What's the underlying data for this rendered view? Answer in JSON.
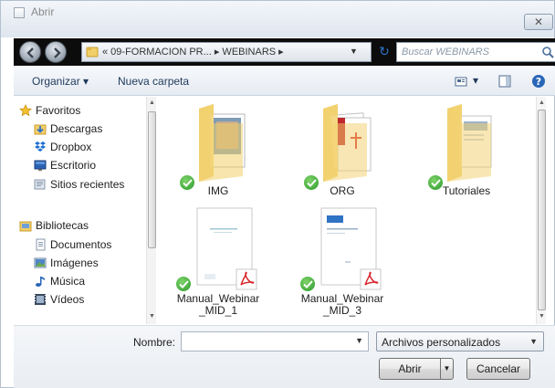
{
  "window": {
    "title": "Abrir",
    "close_glyph": "✕"
  },
  "nav": {
    "path": "« 09-FORMACION PR...  ▸  WEBINARS  ▸",
    "dropdown_glyph": "▼",
    "refresh_glyph": "↻",
    "search_placeholder": "Buscar WEBINARS"
  },
  "toolbar": {
    "organize_label": "Organizar ▾",
    "new_folder_label": "Nueva carpeta",
    "views_glyph": "▾"
  },
  "sidebar": {
    "favorites": {
      "label": "Favoritos",
      "items": [
        {
          "label": "Descargas",
          "icon": "downloads-icon"
        },
        {
          "label": "Dropbox",
          "icon": "dropbox-icon"
        },
        {
          "label": "Escritorio",
          "icon": "desktop-icon"
        },
        {
          "label": "Sitios recientes",
          "icon": "recent-places-icon"
        }
      ]
    },
    "libraries": {
      "label": "Bibliotecas",
      "items": [
        {
          "label": "Documentos",
          "icon": "documents-icon"
        },
        {
          "label": "Imágenes",
          "icon": "pictures-icon"
        },
        {
          "label": "Música",
          "icon": "music-icon"
        },
        {
          "label": "Vídeos",
          "icon": "videos-icon"
        }
      ]
    }
  },
  "files": [
    {
      "label": "IMG",
      "type": "folder",
      "synced": true
    },
    {
      "label": "ORG",
      "type": "folder",
      "synced": true
    },
    {
      "label": "Tutoriales",
      "type": "folder",
      "synced": true
    },
    {
      "label": "Manual_Webinar\n_MID_1",
      "type": "pdf",
      "synced": true
    },
    {
      "label": "Manual_Webinar\n_MID_3",
      "type": "pdf",
      "synced": true
    }
  ],
  "footer": {
    "name_label": "Nombre:",
    "name_value": "",
    "filter_value": "Archivos personalizados",
    "open_label": "Abrir",
    "cancel_label": "Cancelar"
  },
  "colors": {
    "synced_badge": "#2b9a2b",
    "folder": "#f1cf6a",
    "pdf_red": "#d8272d",
    "toolbar_text": "#1e395b"
  }
}
